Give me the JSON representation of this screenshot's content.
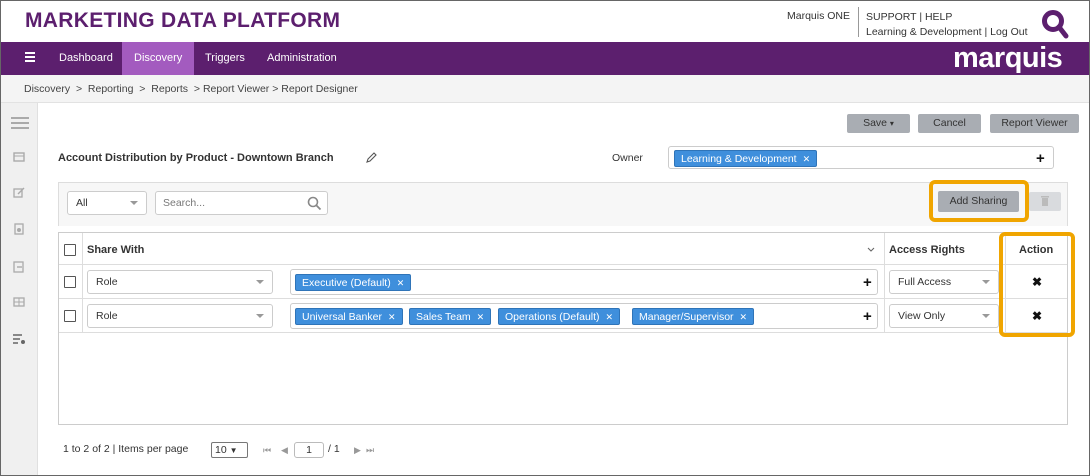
{
  "header": {
    "app_title": "MARKETING DATA PLATFORM",
    "user": "Marquis ONE",
    "support": "SUPPORT",
    "sep": "|",
    "help": "HELP",
    "org": "Learning & Development",
    "logout": "Log Out"
  },
  "nav": {
    "items": [
      {
        "label": "Dashboard",
        "active": false
      },
      {
        "label": "Discovery",
        "active": true
      },
      {
        "label": "Triggers",
        "active": false
      },
      {
        "label": "Administration",
        "active": false
      }
    ],
    "brand": "marquis",
    "accent": "#5c1f6e",
    "active_color": "#a35bbf"
  },
  "breadcrumb": [
    "Discovery",
    "Reporting",
    "Reports",
    "Report Viewer",
    "Report Designer"
  ],
  "breadcrumb_sep": ">",
  "toolbar": {
    "save_label": "Save",
    "cancel_label": "Cancel",
    "viewer_label": "Report Viewer"
  },
  "report": {
    "title": "Account Distribution by Product - Downtown Branch",
    "owner_label": "Owner",
    "owner_tag": "Learning & Development"
  },
  "sharing": {
    "filter_value": "All",
    "search_placeholder": "Search...",
    "add_label": "Add Sharing",
    "highlight_color": "#f0a500"
  },
  "table": {
    "headers": {
      "share_with": "Share With",
      "access_rights": "Access Rights",
      "action": "Action"
    },
    "rows": [
      {
        "type": "Role",
        "tags": [
          "Executive (Default)"
        ],
        "access": "Full Access"
      },
      {
        "type": "Role",
        "tags": [
          "Universal Banker",
          "Sales Team",
          "Operations (Default)",
          "Manager/Supervisor"
        ],
        "access": "View Only"
      }
    ],
    "action_glyph": "✖"
  },
  "pager": {
    "summary": "1 to 2 of 2 | Items per page",
    "per_page": "10",
    "page": "1",
    "total": "/ 1"
  },
  "tag_color": "#3f8fdc"
}
